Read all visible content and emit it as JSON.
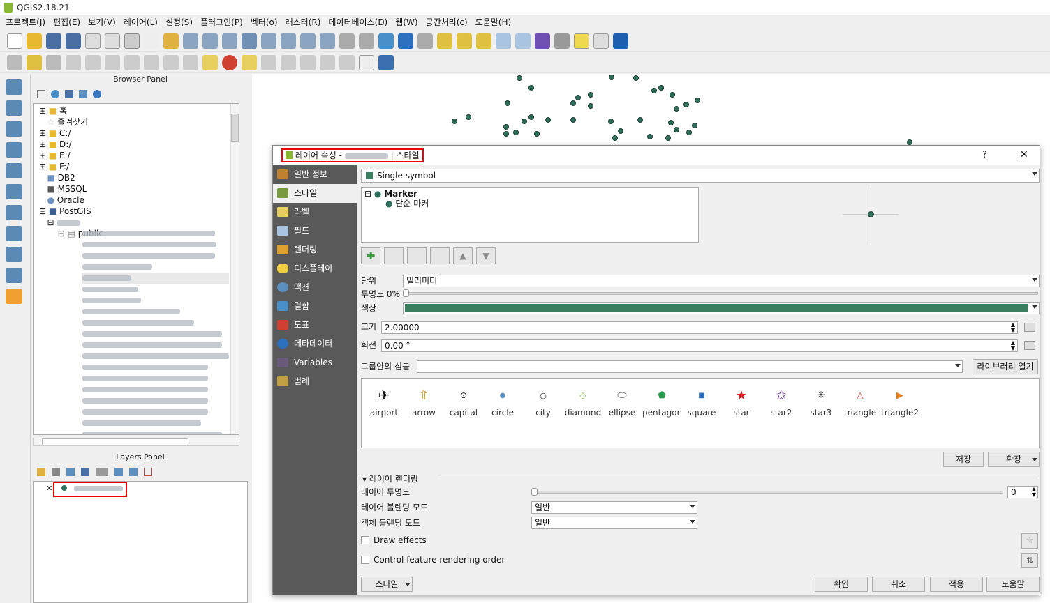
{
  "app": {
    "title": "QGIS2.18.21"
  },
  "menu": [
    "프로젝트(J)",
    "편집(E)",
    "보기(V)",
    "레이어(L)",
    "설정(S)",
    "플러그인(P)",
    "벡터(o)",
    "래스터(R)",
    "데이터베이스(D)",
    "웹(W)",
    "공간처리(c)",
    "도움말(H)"
  ],
  "browser": {
    "title": "Browser Panel",
    "items": [
      "홈",
      "즐겨찾기",
      "C:/",
      "D:/",
      "E:/",
      "F:/",
      "DB2",
      "MSSQL",
      "Oracle",
      "PostGIS"
    ],
    "schema": "public"
  },
  "layers": {
    "title": "Layers Panel"
  },
  "dialog": {
    "title_prefix": "레이어 속성 -",
    "title_suffix": "| 스타일",
    "help": "?",
    "close": "✕",
    "side": [
      "일반 정보",
      "스타일",
      "라벨",
      "필드",
      "렌더링",
      "디스플레이",
      "액션",
      "결합",
      "도표",
      "메타데이터",
      "Variables",
      "범례"
    ],
    "renderer": "Single symbol",
    "tree": {
      "root": "Marker",
      "child": "단순 마커"
    },
    "unit_label": "단위",
    "unit_value": "밀리미터",
    "opacity_label": "투명도 0%",
    "color_label": "색상",
    "color_value": "#3a7d5f",
    "size_label": "크기",
    "size_value": "2.00000",
    "rotation_label": "회전",
    "rotation_value": "0.00 °",
    "group_label": "그룹안의 심볼",
    "library_btn": "라이브러리 열기",
    "symbols": [
      "airport",
      "arrow",
      "capital",
      "circle",
      "city",
      "diamond",
      "ellipse",
      "pentagon",
      "square",
      "star",
      "star2",
      "star3",
      "triangle",
      "triangle2"
    ],
    "save_btn": "저장",
    "expand_btn": "확장",
    "layer_render": "레이어 렌더링",
    "layer_opacity": "레이어 투명도",
    "layer_opacity_value": "0",
    "layer_blend": "레이어 블렌딩 모드",
    "layer_blend_value": "일반",
    "feature_blend": "객체 블렌딩 모드",
    "feature_blend_value": "일반",
    "draw_effects": "Draw effects",
    "control_order": "Control feature rendering order",
    "style_btn": "스타일",
    "ok": "확인",
    "cancel": "취소",
    "apply": "적용",
    "help_btn": "도움말"
  }
}
